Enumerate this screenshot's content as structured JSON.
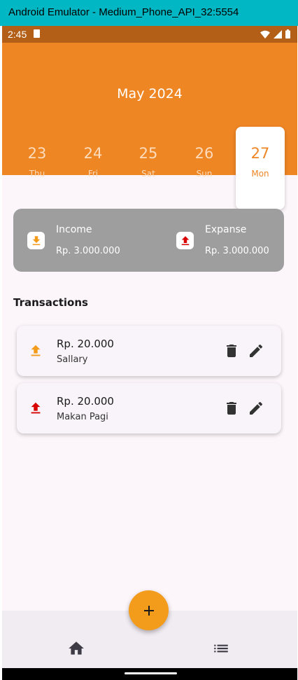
{
  "window": {
    "title": "Android Emulator - Medium_Phone_API_32:5554"
  },
  "status_bar": {
    "time": "2:45"
  },
  "header": {
    "month_label": "May 2024",
    "dates": [
      {
        "day": "23",
        "weekday": "Thu"
      },
      {
        "day": "24",
        "weekday": "Fri"
      },
      {
        "day": "25",
        "weekday": "Sat"
      },
      {
        "day": "26",
        "weekday": "Sun"
      },
      {
        "day": "27",
        "weekday": "Mon",
        "selected": true
      }
    ]
  },
  "summary": {
    "income_label": "Income",
    "income_amount": "Rp. 3.000.000",
    "expense_label": "Expanse",
    "expense_amount": "Rp. 3.000.000"
  },
  "transactions": {
    "title": "Transactions",
    "items": [
      {
        "type": "income",
        "amount": "Rp. 20.000",
        "description": "Sallary"
      },
      {
        "type": "expense",
        "amount": "Rp. 20.000",
        "description": "Makan Pagi"
      }
    ]
  },
  "fab": {
    "label": "+"
  },
  "colors": {
    "primary": "#ef8624",
    "status_bar": "#b35f17",
    "summary_card": "#9e9e9e",
    "income_icon": "#f39c1b",
    "expense_icon": "#d90000",
    "background": "#fcf6fb"
  },
  "icons": {
    "income": "download-icon",
    "expense": "upload-icon",
    "delete": "trash-icon",
    "edit": "pencil-icon",
    "home": "home-icon",
    "list": "list-icon"
  }
}
